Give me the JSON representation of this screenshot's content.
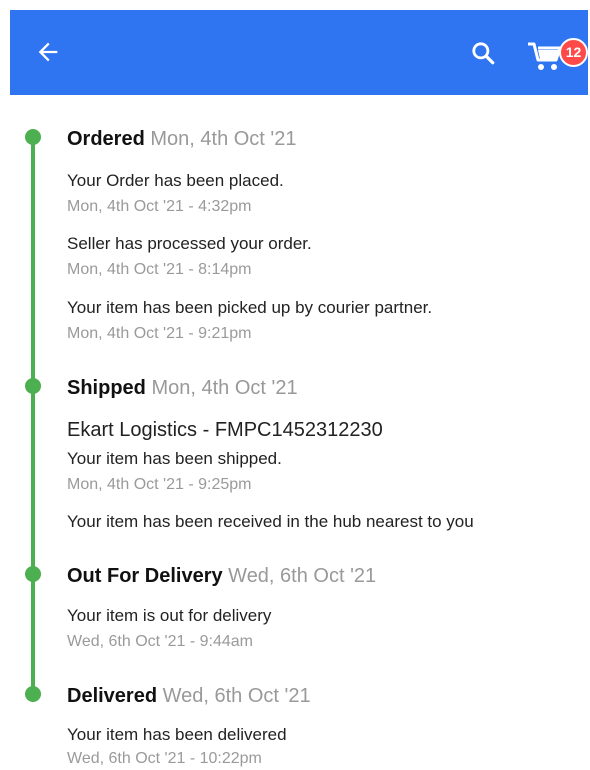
{
  "header": {
    "back_icon": "arrow-left-icon",
    "search_icon": "search-icon",
    "cart_icon": "cart-icon",
    "cart_count": "12",
    "accent": "#2f74f0",
    "badge_color": "#ff4a4a"
  },
  "timeline": {
    "line_color": "#4caf50",
    "stages": [
      {
        "name": "Ordered",
        "date": "Mon, 4th Oct '21",
        "events": [
          {
            "text": "Your Order has been placed.",
            "time": "Mon, 4th Oct '21 - 4:32pm"
          },
          {
            "text": "Seller has processed your order.",
            "time": "Mon, 4th Oct '21 - 8:14pm"
          },
          {
            "text": "Your item has been picked up by courier partner.",
            "time": "Mon, 4th Oct '21 - 9:21pm"
          }
        ]
      },
      {
        "name": "Shipped",
        "date": "Mon, 4th Oct '21",
        "courier": "Ekart Logistics - FMPC1452312230",
        "events": [
          {
            "text": "Your item has been shipped.",
            "time": "Mon, 4th Oct '21 - 9:25pm"
          },
          {
            "text": "Your item has been received in the hub nearest to you",
            "time": ""
          }
        ]
      },
      {
        "name": "Out For Delivery",
        "date": "Wed, 6th Oct '21",
        "events": [
          {
            "text": "Your item is out for delivery",
            "time": "Wed, 6th Oct '21 - 9:44am"
          }
        ]
      },
      {
        "name": "Delivered",
        "date": "Wed, 6th Oct '21",
        "events": [
          {
            "text": "Your item has been delivered",
            "time": "Wed, 6th Oct '21 - 10:22pm"
          }
        ]
      }
    ]
  }
}
